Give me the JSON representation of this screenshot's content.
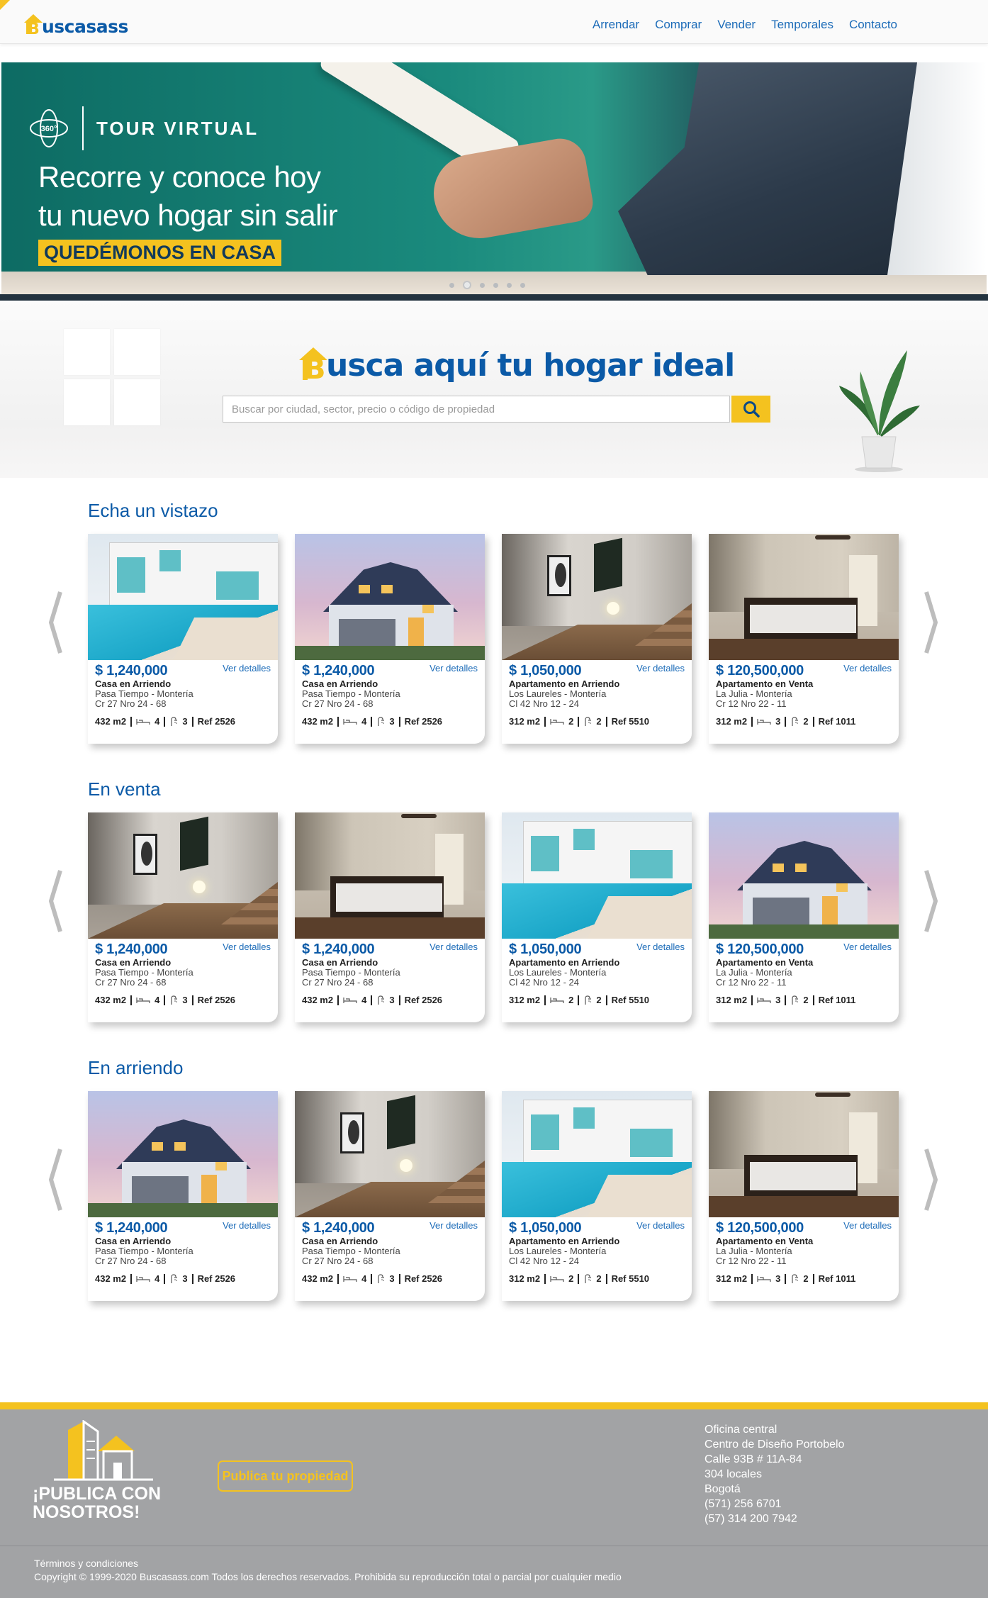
{
  "header": {
    "logo_text": "uscasass",
    "logo_letter": "B",
    "nav": [
      "Arrendar",
      "Comprar",
      "Vender",
      "Temporales",
      "Contacto"
    ]
  },
  "hero": {
    "icon_label": "360°",
    "tour_title": "TOUR VIRTUAL",
    "line1": "Recorre y conoce hoy",
    "line2": "tu nuevo hogar sin salir",
    "badge": "QUEDÉMONOS EN CASA",
    "slides": 6,
    "active_slide": 2
  },
  "search": {
    "title_letter": "B",
    "title_rest": "usca aquí tu hogar ideal",
    "placeholder": "Buscar por ciudad, sector, precio o código de propiedad"
  },
  "sections": [
    {
      "title": "Echa un vistazo",
      "cards": [
        {
          "img": "pool",
          "price": "$ 1,240,000",
          "link": "Ver detalles",
          "type": "Casa en Arriendo",
          "loc": "Pasa Tiempo - Montería",
          "addr": "Cr 27 Nro 24 - 68",
          "area": "432 m2",
          "beds": "4",
          "baths": "3",
          "ref": "Ref 2526"
        },
        {
          "img": "house",
          "price": "$ 1,240,000",
          "link": "Ver detalles",
          "type": "Casa en Arriendo",
          "loc": "Pasa Tiempo - Montería",
          "addr": "Cr 27 Nro 24 - 68",
          "area": "432 m2",
          "beds": "4",
          "baths": "3",
          "ref": "Ref 2526"
        },
        {
          "img": "hall",
          "price": "$ 1,050,000",
          "link": "Ver detalles",
          "type": "Apartamento en Arriendo",
          "loc": "Los Laureles - Montería",
          "addr": "Cl 42 Nro 12 - 24",
          "area": "312 m2",
          "beds": "2",
          "baths": "2",
          "ref": "Ref 5510"
        },
        {
          "img": "bed",
          "price": "$ 120,500,000",
          "link": "Ver detalles",
          "type": "Apartamento en Venta",
          "loc": "La Julia - Montería",
          "addr": "Cr 12 Nro 22 - 11",
          "area": "312 m2",
          "beds": "3",
          "baths": "2",
          "ref": "Ref 1011"
        }
      ]
    },
    {
      "title": "En venta",
      "cards": [
        {
          "img": "hall",
          "price": "$ 1,240,000",
          "link": "Ver detalles",
          "type": "Casa en Arriendo",
          "loc": "Pasa Tiempo - Montería",
          "addr": "Cr 27 Nro 24 - 68",
          "area": "432 m2",
          "beds": "4",
          "baths": "3",
          "ref": "Ref 2526"
        },
        {
          "img": "bed",
          "price": "$ 1,240,000",
          "link": "Ver detalles",
          "type": "Casa en Arriendo",
          "loc": "Pasa Tiempo - Montería",
          "addr": "Cr 27 Nro 24 - 68",
          "area": "432 m2",
          "beds": "4",
          "baths": "3",
          "ref": "Ref 2526"
        },
        {
          "img": "pool",
          "price": "$ 1,050,000",
          "link": "Ver detalles",
          "type": "Apartamento en Arriendo",
          "loc": "Los Laureles - Montería",
          "addr": "Cl 42 Nro 12 - 24",
          "area": "312 m2",
          "beds": "2",
          "baths": "2",
          "ref": "Ref 5510"
        },
        {
          "img": "house",
          "price": "$ 120,500,000",
          "link": "Ver detalles",
          "type": "Apartamento en Venta",
          "loc": "La Julia - Montería",
          "addr": "Cr 12 Nro 22 - 11",
          "area": "312 m2",
          "beds": "3",
          "baths": "2",
          "ref": "Ref 1011"
        }
      ]
    },
    {
      "title": "En arriendo",
      "cards": [
        {
          "img": "house",
          "price": "$ 1,240,000",
          "link": "Ver detalles",
          "type": "Casa en Arriendo",
          "loc": "Pasa Tiempo - Montería",
          "addr": "Cr 27 Nro 24 - 68",
          "area": "432 m2",
          "beds": "4",
          "baths": "3",
          "ref": "Ref 2526"
        },
        {
          "img": "hall",
          "price": "$ 1,240,000",
          "link": "Ver detalles",
          "type": "Casa en Arriendo",
          "loc": "Pasa Tiempo - Montería",
          "addr": "Cr 27 Nro 24 - 68",
          "area": "432 m2",
          "beds": "4",
          "baths": "3",
          "ref": "Ref 2526"
        },
        {
          "img": "pool",
          "price": "$ 1,050,000",
          "link": "Ver detalles",
          "type": "Apartamento en Arriendo",
          "loc": "Los Laureles - Montería",
          "addr": "Cl 42 Nro 12 - 24",
          "area": "312 m2",
          "beds": "2",
          "baths": "2",
          "ref": "Ref 5510"
        },
        {
          "img": "bed",
          "price": "$ 120,500,000",
          "link": "Ver detalles",
          "type": "Apartamento en Venta",
          "loc": "La Julia - Montería",
          "addr": "Cr 12 Nro 22 - 11",
          "area": "312 m2",
          "beds": "3",
          "baths": "2",
          "ref": "Ref 1011"
        }
      ]
    }
  ],
  "footer": {
    "publica_line1": "¡PUBLICA CON",
    "publica_line2": "NOSOTROS!",
    "publish_button": "Publica tu propiedad",
    "office": [
      "Oficina central",
      "Centro de Diseño Portobelo",
      "Calle 93B # 11A-84",
      "304 locales",
      "Bogotá",
      "(571) 256 6701",
      "(57) 314 200 7942"
    ],
    "terms": "Términos y condiciones",
    "copyright": "Copyright © 1999-2020 Buscasass.com Todos los derechos reservados. Prohibida su reproducción total o parcial por cualquier medio"
  },
  "colors": {
    "brand_blue": "#0b5aa7",
    "brand_yellow": "#f4c21f",
    "footer_gray": "#a2a3a5"
  }
}
